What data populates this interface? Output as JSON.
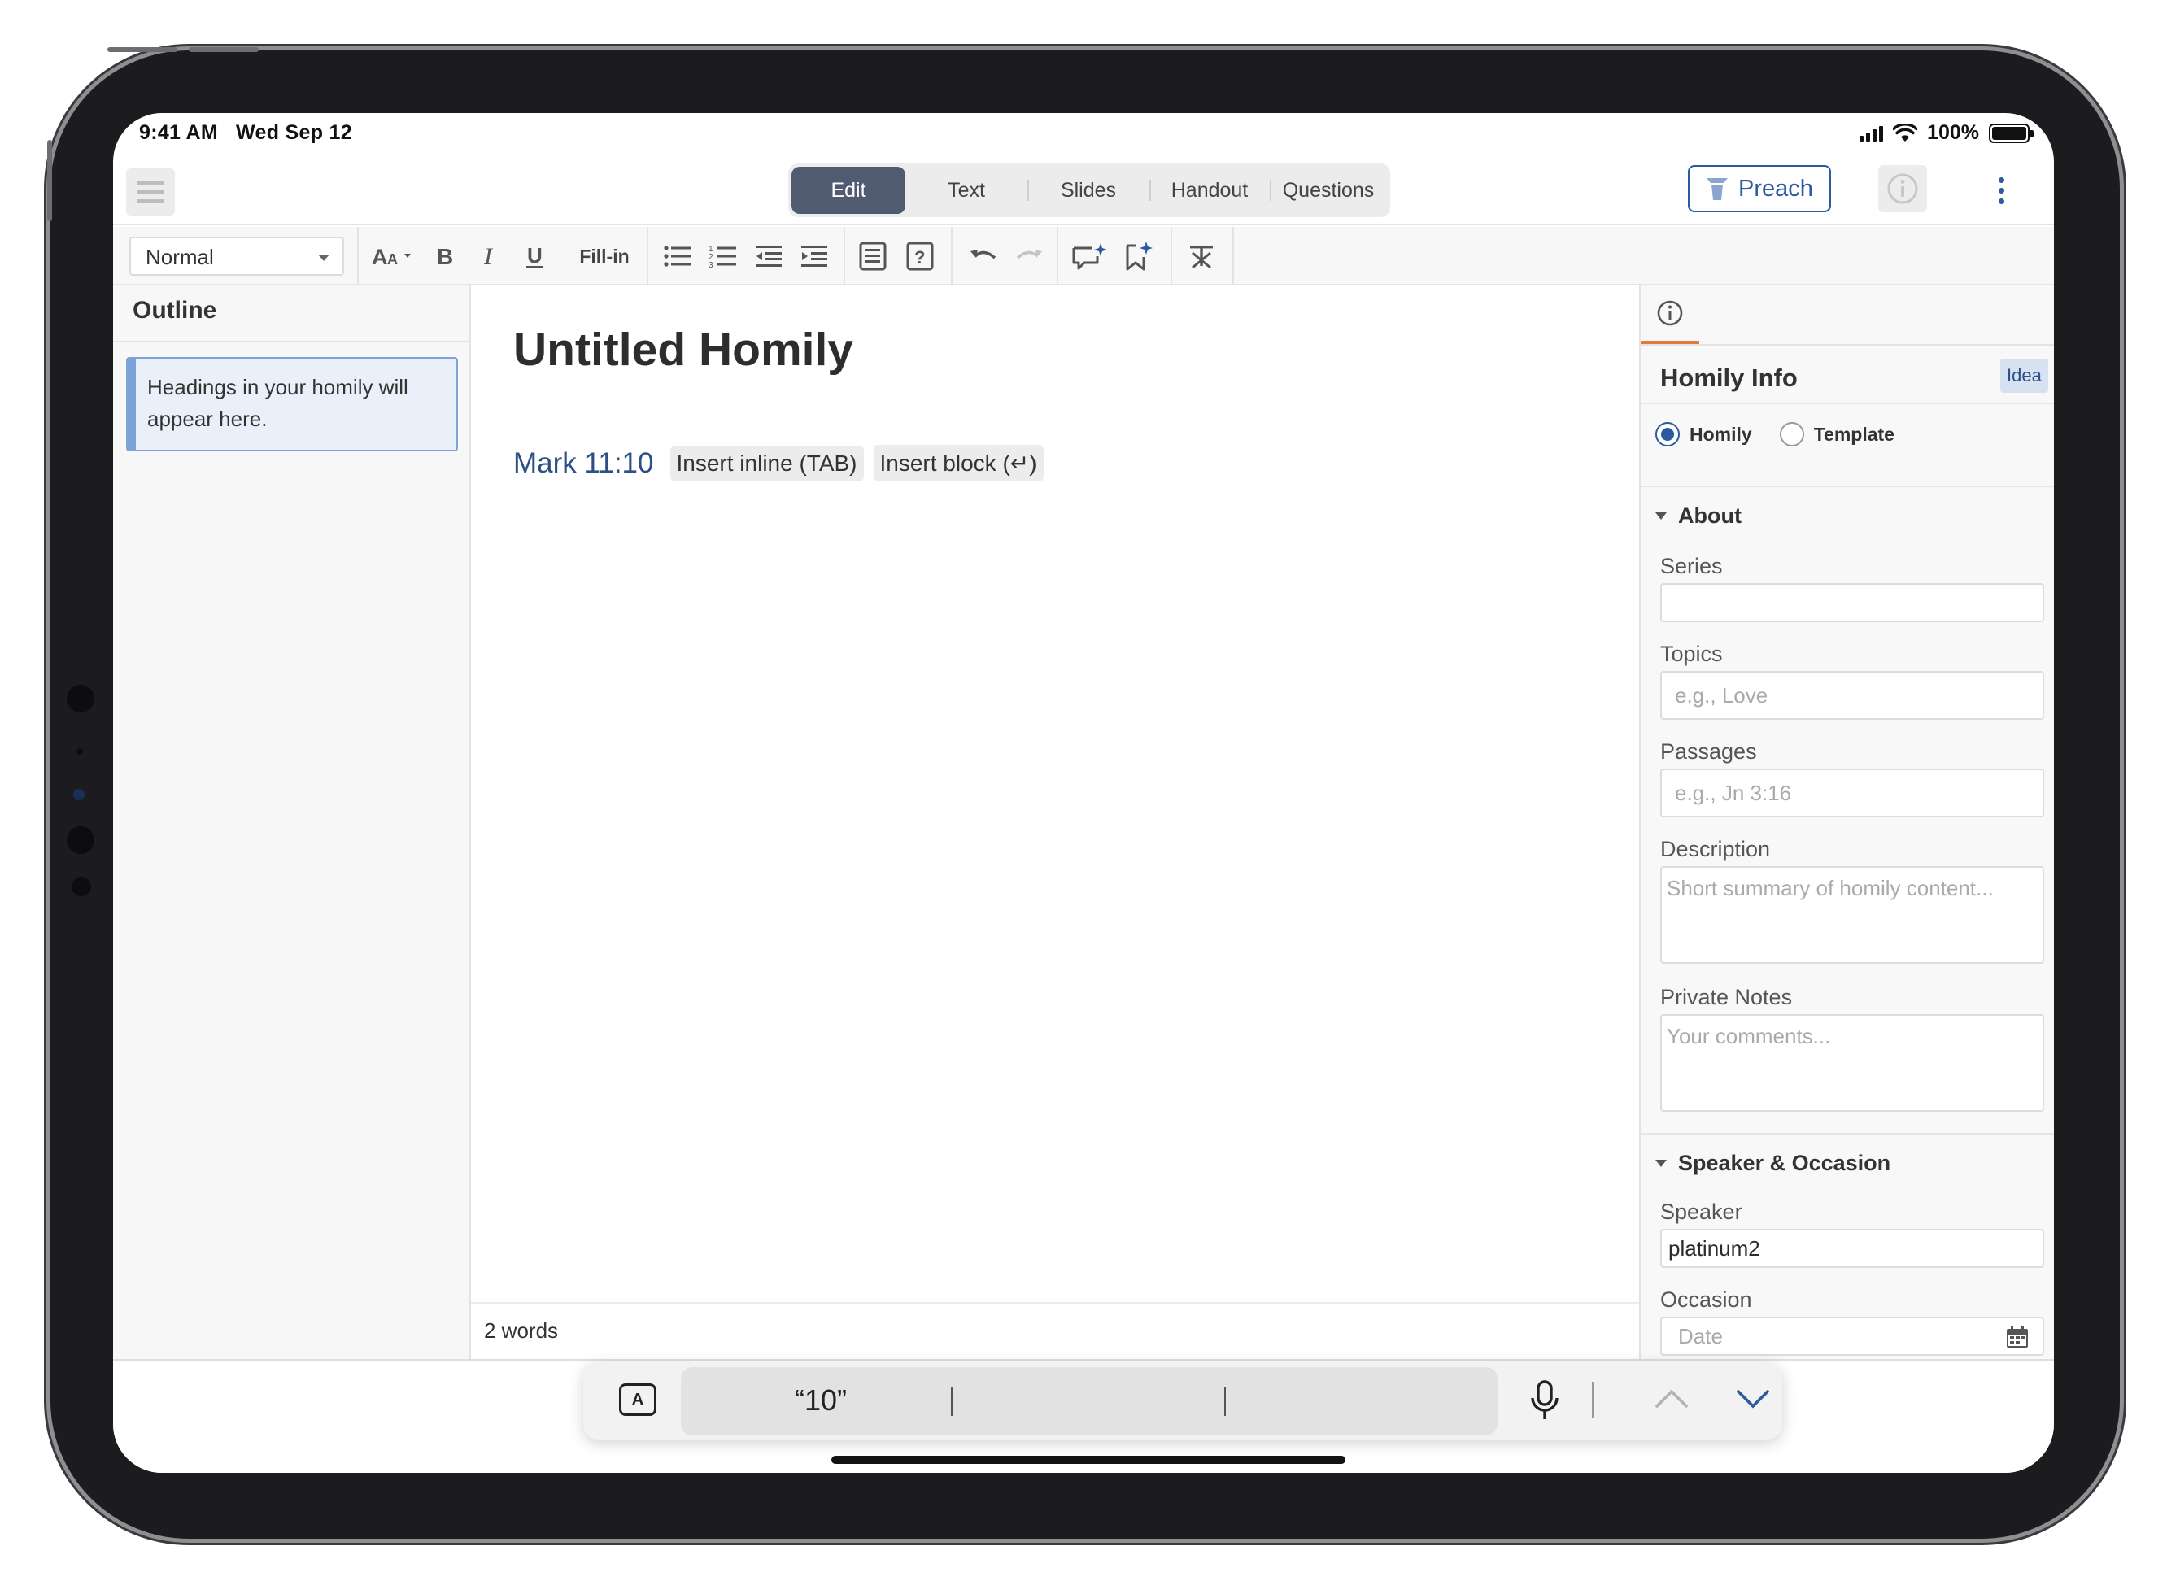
{
  "status_bar": {
    "time": "9:41 AM",
    "date": "Wed Sep 12",
    "battery": "100%"
  },
  "header": {
    "modes": [
      {
        "label": "Edit",
        "active": true
      },
      {
        "label": "Text",
        "active": false
      },
      {
        "label": "Slides",
        "active": false
      },
      {
        "label": "Handout",
        "active": false
      },
      {
        "label": "Questions",
        "active": false
      }
    ],
    "preach_label": "Preach"
  },
  "format_toolbar": {
    "style": "Normal",
    "fill_in_label": "Fill-in",
    "icons": [
      "font-size-icon",
      "bold-icon",
      "italic-icon",
      "underline-icon",
      "bulleted-list-icon",
      "numbered-list-icon",
      "outdent-icon",
      "indent-icon",
      "block-icon",
      "question-icon",
      "undo-icon",
      "redo-icon",
      "comment-sparkle-icon",
      "bookmark-sparkle-icon",
      "clear-format-icon"
    ]
  },
  "outline": {
    "title": "Outline",
    "hint": "Headings in your homily will appear here."
  },
  "editor": {
    "title": "Untitled Homily",
    "verse_ref": "Mark 11:10",
    "insert_inline": "Insert inline (TAB)",
    "insert_block": "Insert block (↵)",
    "word_count": "2 words"
  },
  "info_panel": {
    "title": "Homily Info",
    "badge": "Idea",
    "type_options": [
      {
        "label": "Homily",
        "selected": true
      },
      {
        "label": "Template",
        "selected": false
      }
    ],
    "about": {
      "heading": "About",
      "series_label": "Series",
      "series_value": "",
      "topics_label": "Topics",
      "topics_placeholder": "e.g., Love",
      "passages_label": "Passages",
      "passages_placeholder": "e.g., Jn 3:16",
      "description_label": "Description",
      "description_placeholder": "Short summary of homily content...",
      "notes_label": "Private Notes",
      "notes_placeholder": "Your comments..."
    },
    "speaker_occasion": {
      "heading": "Speaker & Occasion",
      "speaker_label": "Speaker",
      "speaker_value": "platinum2",
      "occasion_label": "Occasion",
      "date_placeholder": "Date"
    }
  },
  "keyboard_bar": {
    "suggestions": [
      "“10”",
      "",
      ""
    ]
  },
  "colors": {
    "accent": "#2c5aa0",
    "active_mode": "#505a70",
    "tab_indicator": "#e07b39"
  }
}
